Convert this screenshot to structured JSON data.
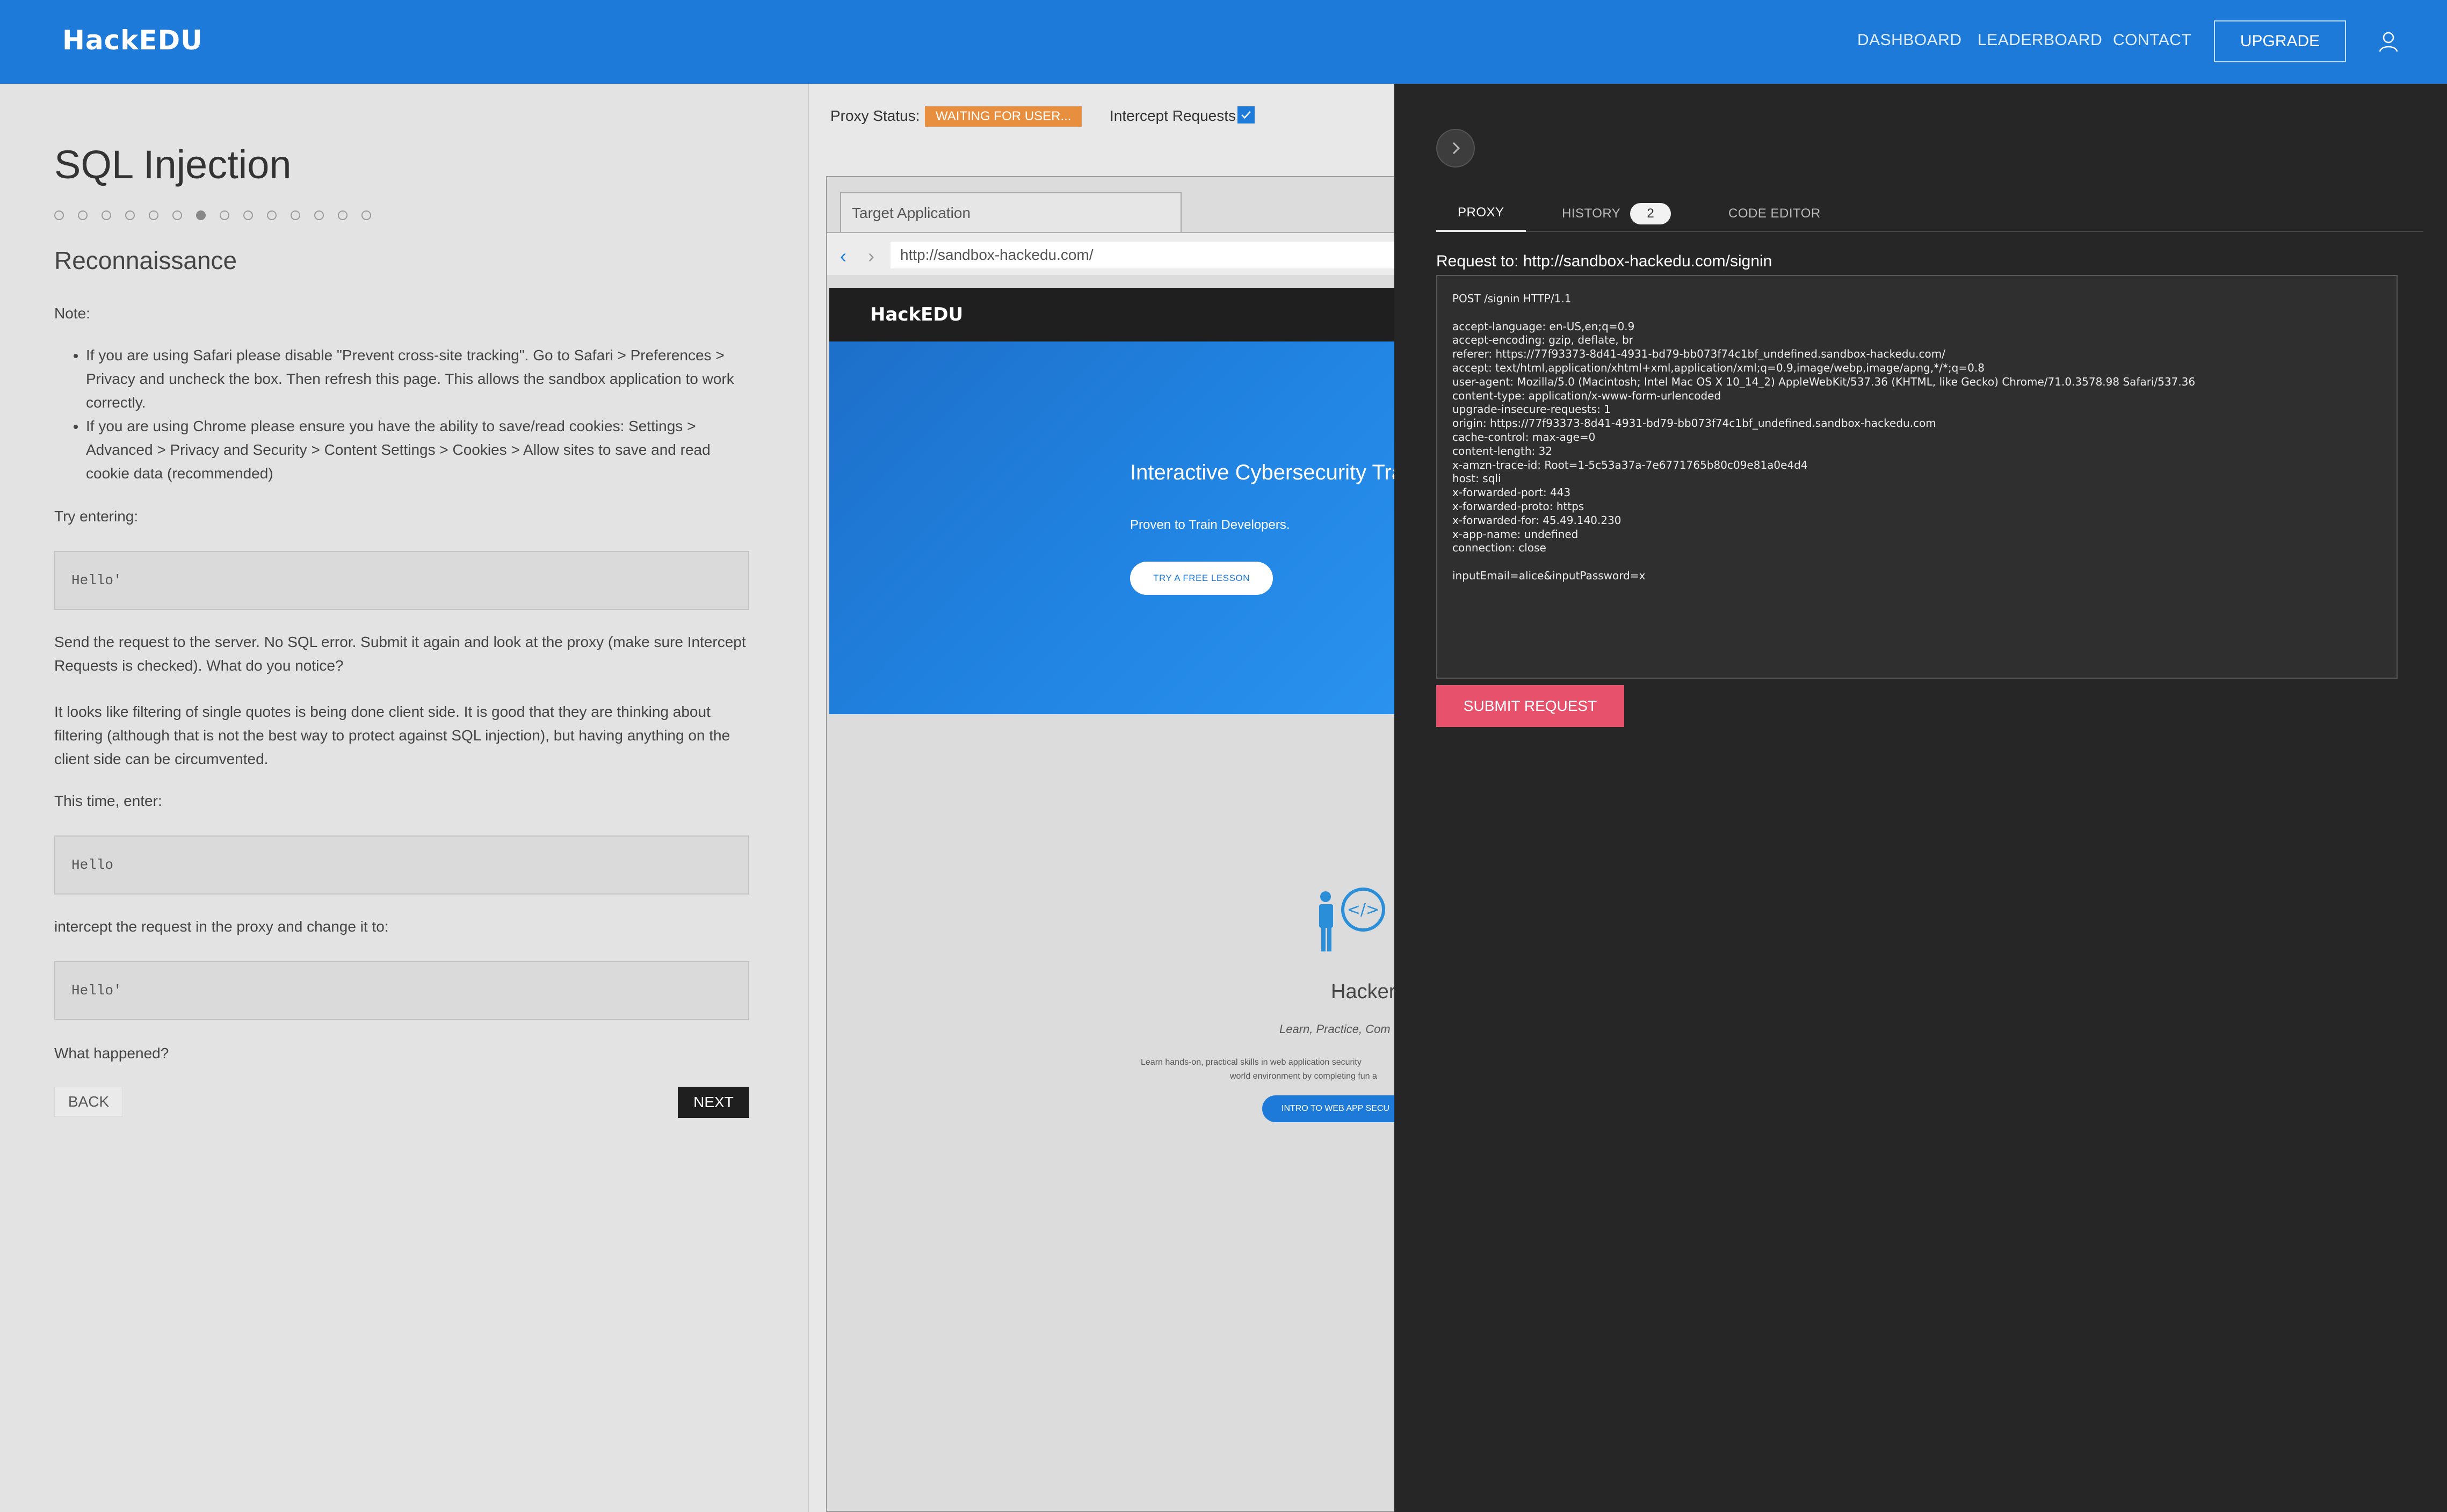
{
  "app": {
    "logo": "HackEDU"
  },
  "nav": {
    "dashboard": "DASHBOARD",
    "leaderboard": "LEADERBOARD",
    "contact": "CONTACT",
    "upgrade": "UPGRADE"
  },
  "lesson": {
    "title": "SQL Injection",
    "progress": {
      "total_steps": 14,
      "current_step": 7
    },
    "section": "Reconnaissance",
    "note_label": "Note:",
    "bullets": [
      "If you are using Safari please disable \"Prevent cross-site tracking\". Go to Safari > Preferences > Privacy and uncheck the box. Then refresh this page. This allows the sandbox application to work correctly.",
      "If you are using Chrome please ensure you have the ability to save/read cookies: Settings > Advanced > Privacy and Security > Content Settings > Cookies > Allow sites to save and read cookie data (recommended)"
    ],
    "try_entering": "Try entering:",
    "code1": "Hello'",
    "para1": "Send the request to the server. No SQL error. Submit it again and look at the proxy (make sure Intercept Requests is checked). What do you notice?",
    "para2": "It looks like filtering of single quotes is being done client side. It is good that they are thinking about filtering (although that is not the best way to protect against SQL injection), but having anything on the client side can be circumvented.",
    "this_time": "This time, enter:",
    "code2": "Hello",
    "intercept_text": "intercept the request in the proxy and change it to:",
    "code3": "Hello'",
    "what_happened": "What happened?",
    "back": "BACK",
    "next": "NEXT"
  },
  "target": {
    "proxy_status_label": "Proxy Status:",
    "proxy_status": "WAITING FOR USER...",
    "intercept_label": "Intercept Requests",
    "intercept_checked": true,
    "tab_label": "Target Application",
    "url": "http://sandbox-hackedu.com/",
    "site_logo": "HackEDU",
    "hero_title": "Interactive Cybersecurity Train",
    "hero_sub": "Proven to Train Developers.",
    "hero_btn": "TRY A FREE LESSON",
    "hackers_title": "Hackers",
    "hackers_sub": "Learn, Practice, Com",
    "hackers_desc1": "Learn hands-on, practical skills in web application security",
    "hackers_desc2": "world environment by completing fun a",
    "hackers_btn": "INTRO TO WEB APP SECU"
  },
  "proxy": {
    "tabs": {
      "proxy": "PROXY",
      "history": "HISTORY",
      "history_count": "2",
      "code_editor": "CODE EDITOR"
    },
    "request_to": "Request to: http://sandbox-hackedu.com/signin",
    "request_body": "POST /signin HTTP/1.1\n\naccept-language: en-US,en;q=0.9\naccept-encoding: gzip, deflate, br\nreferer: https://77f93373-8d41-4931-bd79-bb073f74c1bf_undefined.sandbox-hackedu.com/\naccept: text/html,application/xhtml+xml,application/xml;q=0.9,image/webp,image/apng,*/*;q=0.8\nuser-agent: Mozilla/5.0 (Macintosh; Intel Mac OS X 10_14_2) AppleWebKit/537.36 (KHTML, like Gecko) Chrome/71.0.3578.98 Safari/537.36\ncontent-type: application/x-www-form-urlencoded\nupgrade-insecure-requests: 1\norigin: https://77f93373-8d41-4931-bd79-bb073f74c1bf_undefined.sandbox-hackedu.com\ncache-control: max-age=0\ncontent-length: 32\nx-amzn-trace-id: Root=1-5c53a37a-7e6771765b80c09e81a0e4d4\nhost: sqli\nx-forwarded-port: 443\nx-forwarded-proto: https\nx-forwarded-for: 45.49.140.230\nx-app-name: undefined\nconnection: close\n\ninputEmail=alice&inputPassword=x",
    "submit": "SUBMIT REQUEST"
  },
  "colors": {
    "brand_blue": "#1e7ad9",
    "proxy_bg": "#262626",
    "status_orange": "#e88f3f",
    "submit_pink": "#e8516c"
  }
}
